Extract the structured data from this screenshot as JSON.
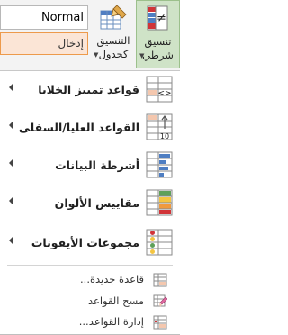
{
  "ribbon": {
    "style_normal": "Normal",
    "style_input": "إدخال",
    "format_as_table_label": "التنسيق\nكجدول",
    "conditional_formatting_label": "تنسيق\nشرطي"
  },
  "menu": {
    "items": [
      {
        "label": "قواعد تمييز الخلايا",
        "icon": "highlight-cells-rules-icon"
      },
      {
        "label": "القواعد العليا/السفلى",
        "icon": "top-bottom-rules-icon"
      },
      {
        "label": "أشرطة البيانات",
        "icon": "data-bars-icon"
      },
      {
        "label": "مقاييس الألوان",
        "icon": "color-scales-icon"
      },
      {
        "label": "مجموعات الأيقونات",
        "icon": "icon-sets-icon"
      }
    ],
    "small_items": [
      {
        "label": "قاعدة جديدة...",
        "icon": "new-rule-icon"
      },
      {
        "label": "مسح القواعد",
        "icon": "clear-rules-icon"
      },
      {
        "label": "إدارة القواعد...",
        "icon": "manage-rules-icon"
      }
    ]
  },
  "colors": {
    "accent_green": "#cfe3c7",
    "input_orange_bg": "#fbe5d6",
    "input_orange_border": "#ed9a4b"
  }
}
